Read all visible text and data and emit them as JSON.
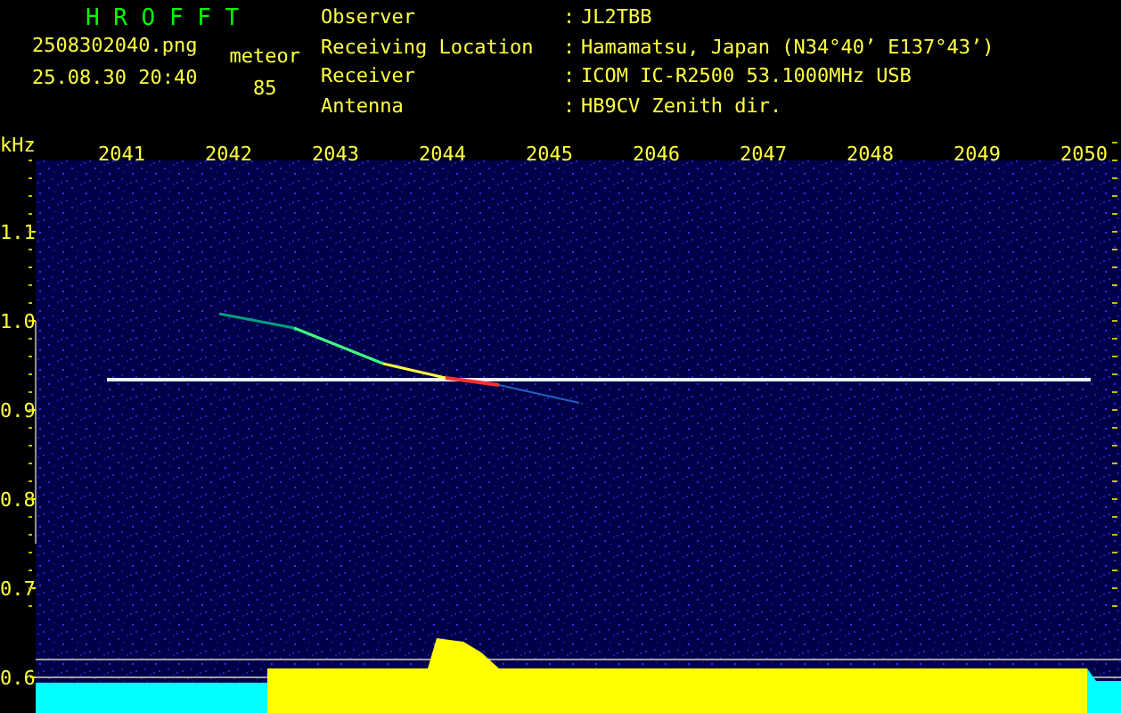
{
  "title": "H R O F F T",
  "file_name": "2508302040.png",
  "timestamp": "25.08.30 20:40",
  "meteor": {
    "label": "meteor",
    "count": "85"
  },
  "info": [
    {
      "label": "Observer",
      "separator": ":",
      "value": "JL2TBB"
    },
    {
      "label": "Receiving Location",
      "separator": ":",
      "value": "Hamamatsu, Japan (N34°40’ E137°43’)"
    },
    {
      "label": "Receiver",
      "separator": ":",
      "value": "ICOM IC-R2500 53.1000MHz USB"
    },
    {
      "label": "Antenna",
      "separator": ":",
      "value": "HB9CV Zenith dir."
    }
  ],
  "spectrogram": {
    "y_unit": "kHz",
    "x_ticks": [
      "2041",
      "2042",
      "2043",
      "2044",
      "2045",
      "2046",
      "2047",
      "2048",
      "2049",
      "2050"
    ],
    "y_ticks": [
      "1.1",
      "1.0",
      "0.9",
      "0.8",
      "0.7",
      "0.6"
    ]
  }
}
